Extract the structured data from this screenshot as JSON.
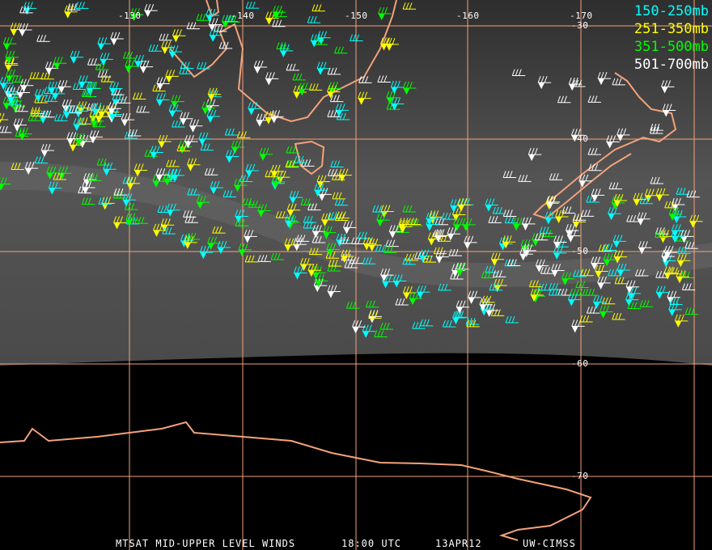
{
  "longitude_labels": [
    "-130",
    "-140",
    "-150",
    "-160",
    "-170"
  ],
  "latitude_labels": [
    "-30",
    "-40",
    "-50",
    "-60",
    "-70"
  ],
  "legend": [
    {
      "label": "150-250mb",
      "color": "#00ffff"
    },
    {
      "label": "251-350mb",
      "color": "#ffff00"
    },
    {
      "label": "351-500mb",
      "color": "#00ff00"
    },
    {
      "label": "501-700mb",
      "color": "#ffffff"
    }
  ],
  "caption": {
    "title": "MTSAT MID-UPPER LEVEL WINDS",
    "time": "18:00 UTC",
    "date": "13APR12",
    "source": "UW-CIMSS"
  },
  "colors": {
    "grid": "#f4a27a",
    "coast": "#f4a27a"
  }
}
